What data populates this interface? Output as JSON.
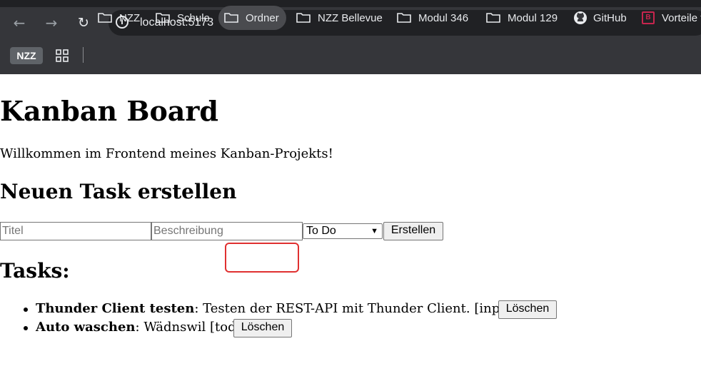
{
  "browser": {
    "url": "localhost:5173",
    "bookmarks": [
      {
        "label": "NZZ",
        "icon": "nzz-badge"
      },
      {
        "label": "",
        "icon": "apps-grid-icon"
      },
      {
        "label": "NZZ",
        "icon": "folder-icon"
      },
      {
        "label": "Schule",
        "icon": "folder-icon"
      },
      {
        "label": "Ordner",
        "icon": "folder-icon"
      },
      {
        "label": "NZZ Bellevue",
        "icon": "folder-icon"
      },
      {
        "label": "Modul 346",
        "icon": "folder-icon"
      },
      {
        "label": "Modul 129",
        "icon": "folder-icon"
      },
      {
        "label": "GitHub",
        "icon": "github-icon"
      },
      {
        "label": "Vorteile f",
        "icon": "b-icon"
      }
    ]
  },
  "page": {
    "title": "Kanban Board",
    "intro": "Willkommen im Frontend meines Kanban-Projekts!",
    "new_task_heading": "Neuen Task erstellen",
    "form": {
      "title_placeholder": "Titel",
      "description_placeholder": "Beschreibung",
      "status_selected": "To Do",
      "submit_label": "Erstellen"
    },
    "tasks_heading": "Tasks:",
    "tasks": [
      {
        "title": "Thunder Client testen",
        "description": ": Testen der REST-API mit Thunder Client. [inprogress]",
        "delete_label": "Löschen"
      },
      {
        "title": "Auto waschen",
        "description": ": Wädnswil [todo]",
        "delete_label": "Löschen"
      }
    ]
  }
}
